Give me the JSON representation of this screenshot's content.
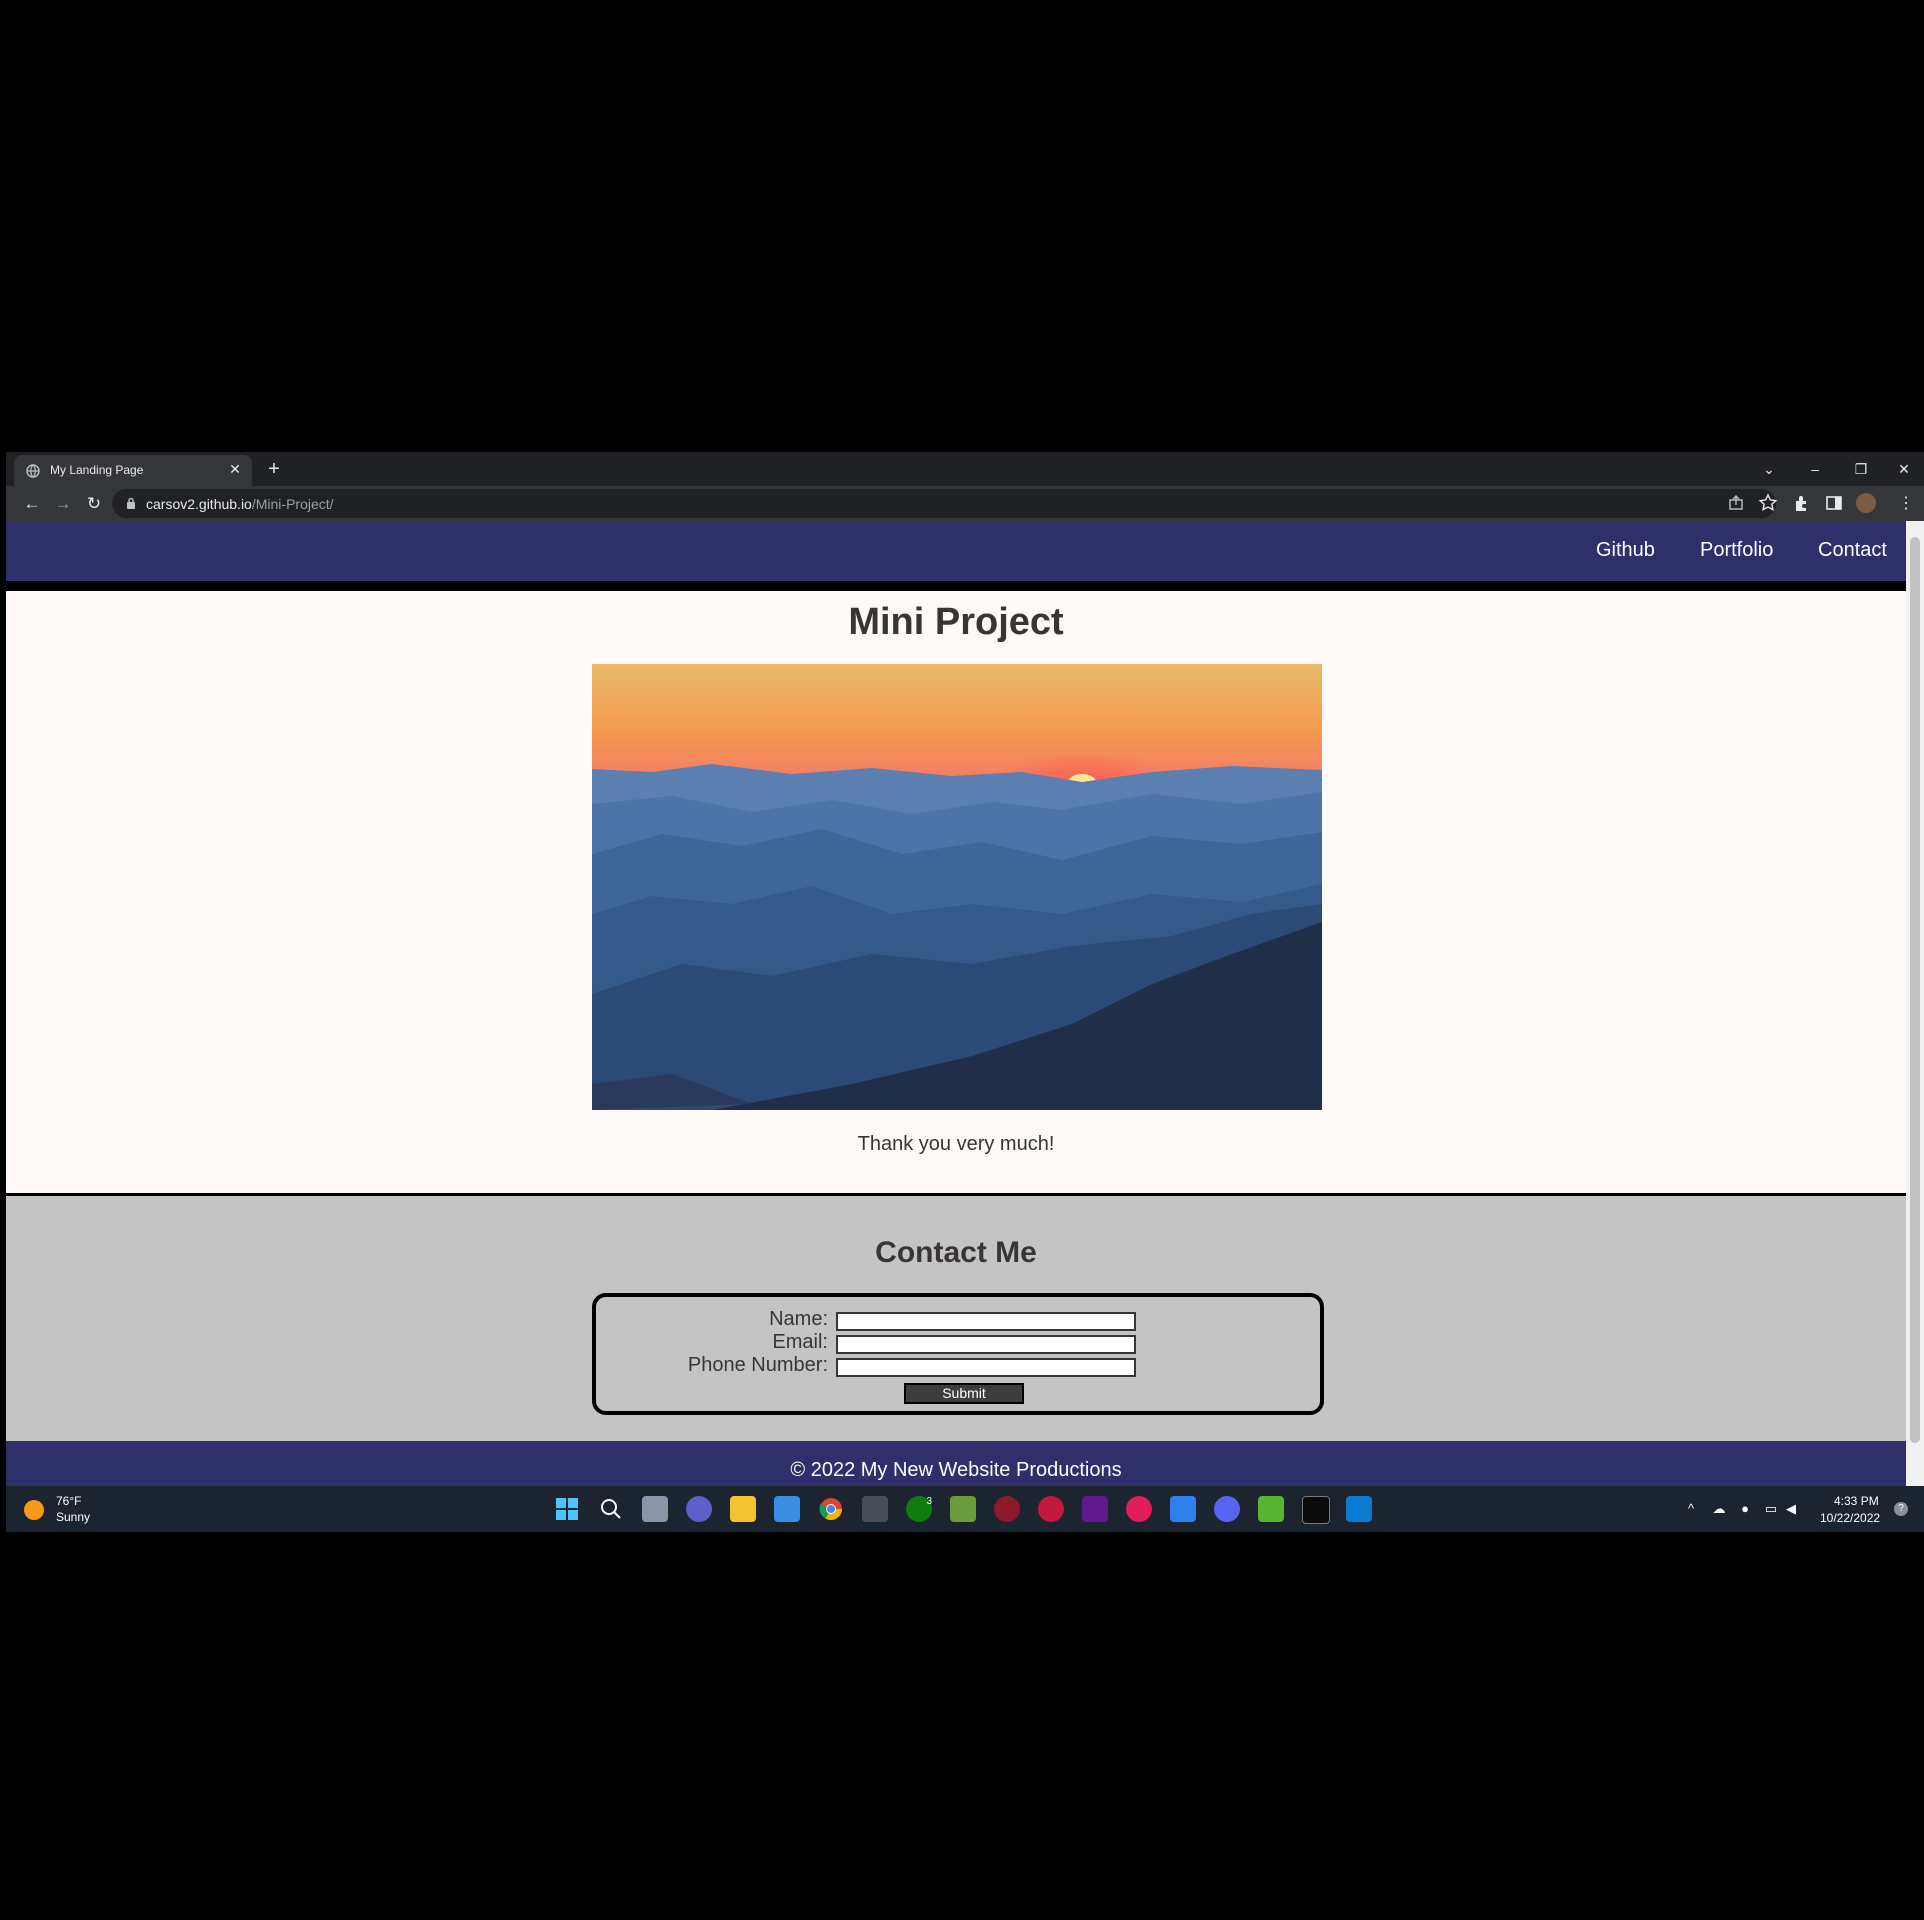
{
  "browser": {
    "tab_title": "My Landing Page",
    "url_host": "carsov2.github.io",
    "url_path": "/Mini-Project/"
  },
  "nav": {
    "links": [
      "Github",
      "Portfolio",
      "Contact"
    ]
  },
  "main": {
    "title": "Mini Project",
    "hero_alt": "Sunset over blue mountain ridges",
    "thanks": "Thank you very much!"
  },
  "contact": {
    "title": "Contact Me",
    "name_label": "Name:",
    "email_label": "Email:",
    "phone_label": "Phone Number:",
    "submit_label": "Submit"
  },
  "footer": {
    "copyright": "© 2022 My New Website Productions"
  },
  "taskbar": {
    "weather_temp": "76°F",
    "weather_desc": "Sunny",
    "time": "4:33 PM",
    "date": "10/22/2022",
    "xbox_badge": "3"
  },
  "colors": {
    "header_bg": "#2e2f6b",
    "page_bg": "#fffaf7",
    "contact_bg": "#c4c4c4",
    "text": "#3a3535"
  }
}
